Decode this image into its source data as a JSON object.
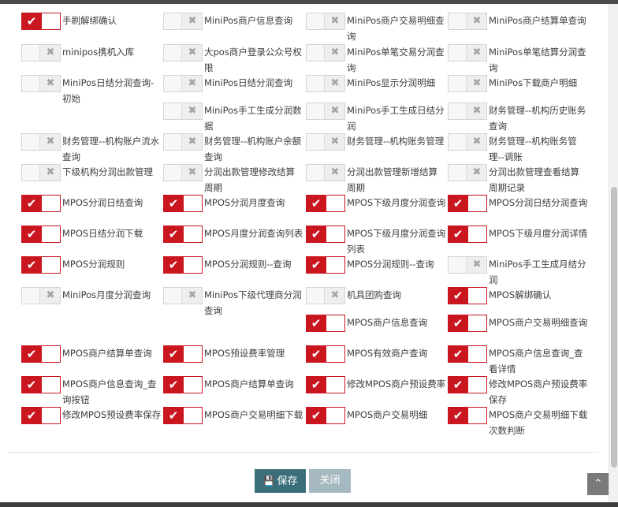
{
  "permissions": [
    {
      "label": "手刷解绑确认",
      "checked": true
    },
    {
      "label": "MiniPos商户信息查询",
      "checked": false
    },
    {
      "label": "MiniPos商户交易明细查询",
      "checked": false
    },
    {
      "label": "MiniPos商户结算单查询",
      "checked": false
    },
    {
      "label": "minipos携机入库",
      "checked": false
    },
    {
      "label": "大pos商户登录公众号权限",
      "checked": false
    },
    {
      "label": "MiniPos单笔交易分润查询",
      "checked": false
    },
    {
      "label": "MiniPos单笔结算分润查询",
      "checked": false
    },
    {
      "label": "MiniPos日结分润查询-初始",
      "checked": false
    },
    {
      "label": "MiniPos日结分润查询",
      "checked": false
    },
    {
      "label": "MiniPos显示分润明细",
      "checked": false
    },
    {
      "label": "MiniPos下载商户明细",
      "checked": false
    },
    {
      "label": "MiniPos手工生成分润数据",
      "checked": false
    },
    {
      "label": "MiniPos手工生成日结分润",
      "checked": false
    },
    {
      "label": "财务管理--机构历史账务查询",
      "checked": false
    },
    {
      "label": "财务管理--机构账户流水查询",
      "checked": false
    },
    {
      "label": "财务管理--机构账户余额查询",
      "checked": false
    },
    {
      "label": "财务管理--机构账务管理",
      "checked": false
    },
    {
      "label": "财务管理--机构账务管理--调账",
      "checked": false
    },
    {
      "label": "下级机构分润出款管理",
      "checked": false
    },
    {
      "label": "分润出款管理修改结算周期",
      "checked": false
    },
    {
      "label": "分润出款管理新增结算周期",
      "checked": false
    },
    {
      "label": "分润出款管理查看结算周期记录",
      "checked": false
    },
    {
      "label": "MPOS分润日结查询",
      "checked": true
    },
    {
      "label": "MPOS分润月度查询",
      "checked": true
    },
    {
      "label": "MPOS下级月度分润查询",
      "checked": true
    },
    {
      "label": "MPOS分润日结分润查询",
      "checked": true
    },
    {
      "label": "MPOS日结分润下载",
      "checked": true
    },
    {
      "label": "MPOS月度分润查询列表",
      "checked": true
    },
    {
      "label": "MPOS下级月度分润查询列表",
      "checked": true
    },
    {
      "label": "MPOS下级月度分润详情",
      "checked": true
    },
    {
      "label": "MPOS分润规则",
      "checked": true
    },
    {
      "label": "MPOS分润规则--查询",
      "checked": true
    },
    {
      "label": "MPOS分润规则--查询",
      "checked": true
    },
    {
      "label": "MiniPos手工生成月结分润",
      "checked": false
    },
    {
      "label": "MiniPos月度分润查询",
      "checked": false
    },
    {
      "label": "MiniPos下级代理商分润查询",
      "checked": false
    },
    {
      "label": "机具团购查询",
      "checked": false
    },
    {
      "label": "MPOS解绑确认",
      "checked": true
    },
    {
      "label": "MPOS商户信息查询",
      "checked": true
    },
    {
      "label": "MPOS商户交易明细查询",
      "checked": true
    },
    {
      "label": "MPOS商户结算单查询",
      "checked": true
    },
    {
      "label": "MPOS预设费率管理",
      "checked": true
    },
    {
      "label": "MPOS有效商户查询",
      "checked": true
    },
    {
      "label": "MPOS商户信息查询_查看详情",
      "checked": true
    },
    {
      "label": "MPOS商户信息查询_查询按钮",
      "checked": true
    },
    {
      "label": "MPOS商户结算单查询",
      "checked": true
    },
    {
      "label": "修改MPOS商户预设费率",
      "checked": true
    },
    {
      "label": "修改MPOS商户预设费率保存",
      "checked": true
    },
    {
      "label": "修改MPOS预设费率保存",
      "checked": true
    },
    {
      "label": "MPOS商户交易明细下载",
      "checked": true
    },
    {
      "label": "MPOS商户交易明细",
      "checked": true
    },
    {
      "label": "MPOS商户交易明细下载次数判断",
      "checked": true
    }
  ],
  "toggle_icons": {
    "on": "checkmark-icon",
    "off": "x-icon"
  },
  "buttons": {
    "save": "保存",
    "close": "关闭"
  },
  "colors": {
    "on": "#c9161f",
    "save": "#3a6f79",
    "close": "#a6b9c0"
  }
}
